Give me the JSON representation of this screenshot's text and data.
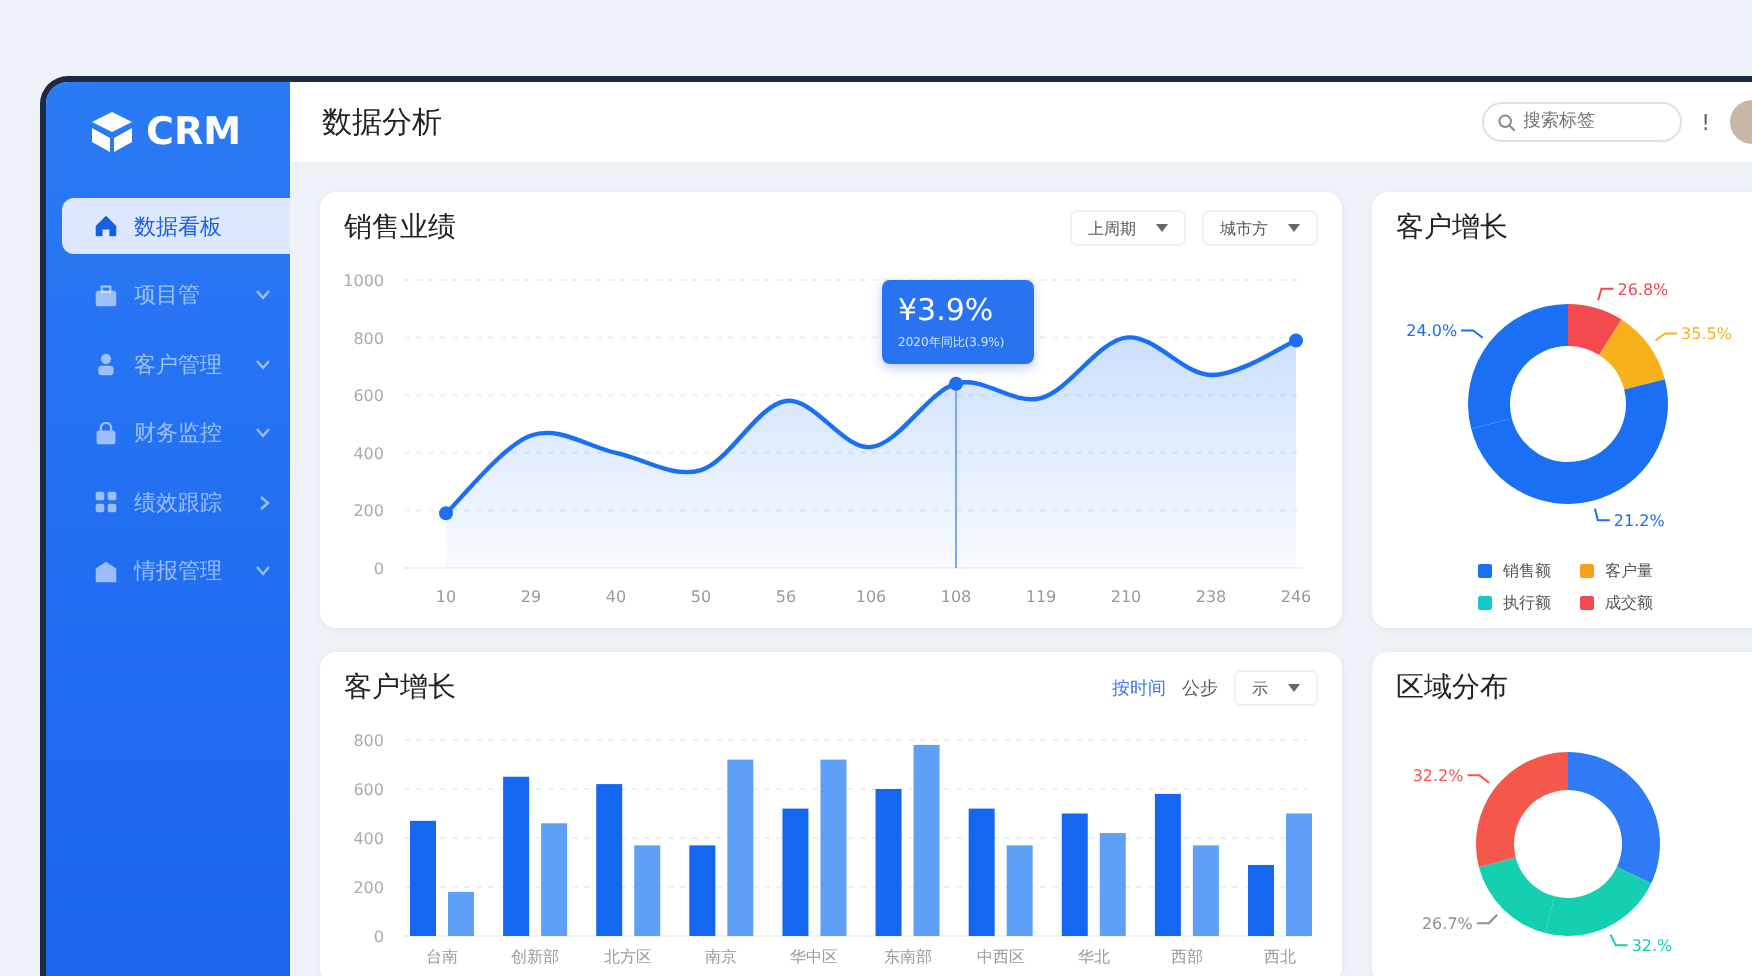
{
  "sidebar": {
    "logo": "CRM",
    "items": [
      {
        "label": "数据看板",
        "selected": true,
        "kind": "link"
      },
      {
        "label": "项目管",
        "selected": false,
        "kind": "expandable"
      },
      {
        "label": "客户管理",
        "selected": false,
        "kind": "expandable"
      },
      {
        "label": "财务监控",
        "selected": false,
        "kind": "expandable"
      },
      {
        "label": "绩效跟踪",
        "selected": false,
        "kind": "flyout"
      },
      {
        "label": "情报管理",
        "selected": false,
        "kind": "expandable"
      }
    ]
  },
  "header": {
    "title": "数据分析",
    "search": {
      "placeholder": "搜索标签"
    },
    "alert": "!"
  },
  "sales_card": {
    "title": "销售业绩",
    "controls": [
      {
        "kind": "dropdown",
        "label": "上周期"
      },
      {
        "kind": "dropdown",
        "label": "城市方"
      }
    ],
    "tooltip_caption": "2020年同比(3.9%)",
    "chart_data": {
      "type": "area",
      "categories": [
        "10",
        "29",
        "40",
        "50",
        "56",
        "106",
        "108",
        "119",
        "210",
        "238",
        "246"
      ],
      "series": [
        {
          "color": "#1a6ff5",
          "values": [
            190,
            460,
            400,
            340,
            580,
            420,
            640,
            590,
            800,
            670,
            790
          ]
        }
      ],
      "ylim": [
        0,
        1000
      ],
      "yticks": [
        0,
        200,
        400,
        600,
        800,
        1000
      ],
      "grid": true,
      "ref_lines": [
        {
          "axis": "x",
          "value": "108"
        }
      ],
      "annotations": [
        {
          "x": "108",
          "y": 640,
          "text": "¥3.9%"
        }
      ]
    }
  },
  "customer_card": {
    "title": "客户增长",
    "slice_labels": [
      {
        "text": "26.8%",
        "color": "#f24a4f"
      },
      {
        "text": "35.5%",
        "color": "#f7b21b"
      },
      {
        "text": "21.2%",
        "color": "#1a6ff5"
      },
      {
        "text": "24.0%",
        "color": "#1a6ff5"
      }
    ],
    "legend": [
      {
        "label": "销售额",
        "color": "#1a6ff5"
      },
      {
        "label": "客户量",
        "color": "#f7a01b"
      },
      {
        "label": "执行额",
        "color": "#14c9c9"
      },
      {
        "label": "成交额",
        "color": "#f24a4f"
      }
    ]
  },
  "growth_card": {
    "title": "客户增长",
    "controls": [
      {
        "kind": "link",
        "label": "按时间"
      },
      {
        "kind": "text",
        "label": "公步"
      },
      {
        "kind": "dropdown",
        "label": "示"
      }
    ],
    "chart_data": {
      "type": "bar",
      "categories": [
        "台南",
        "创新部",
        "北方区",
        "南京",
        "华中区",
        "东南部",
        "中西区",
        "华北",
        "西部",
        "西北"
      ],
      "series": [
        {
          "color": "#1467f0",
          "values": [
            470,
            650,
            620,
            370,
            520,
            600,
            520,
            500,
            580,
            290
          ]
        },
        {
          "color": "#5ea0f7",
          "values": [
            180,
            460,
            370,
            720,
            720,
            780,
            370,
            420,
            370,
            500
          ]
        }
      ],
      "ylim": [
        0,
        800
      ],
      "yticks": [
        0,
        200,
        400,
        600,
        800
      ],
      "grid": true
    }
  },
  "region_card": {
    "title": "区域分布",
    "slice_labels": [
      {
        "text": "32.%",
        "color": "#14d0b0"
      },
      {
        "text": "26.7%",
        "color": "#8a8f99"
      },
      {
        "text": "32.2%",
        "color": "#f4584a"
      }
    ]
  }
}
